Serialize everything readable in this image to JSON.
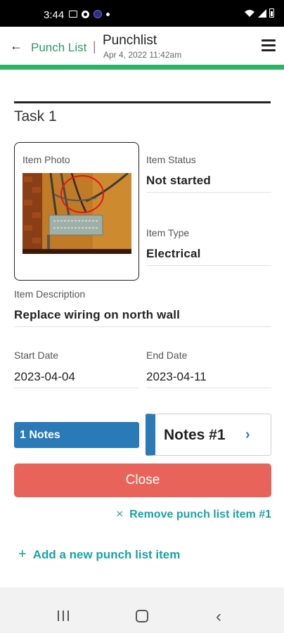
{
  "status_bar": {
    "time": "3:44"
  },
  "header": {
    "back_label": "Punch List",
    "separator": "|",
    "title": "Punchlist",
    "subtitle": "Apr 4, 2022 11:42am",
    "back_icon": "arrow-left-icon",
    "menu_icon": "hamburger-menu-icon"
  },
  "task": {
    "title": "Task 1",
    "photo_label": "Item Photo",
    "status": {
      "label": "Item Status",
      "value": "Not started"
    },
    "type": {
      "label": "Item Type",
      "value": "Electrical"
    },
    "description": {
      "label": "Item Description",
      "value": "Replace wiring on north wall"
    },
    "start_date": {
      "label": "Start Date",
      "value": "2023-04-04"
    },
    "end_date": {
      "label": "End Date",
      "value": "2023-04-11"
    }
  },
  "notes": {
    "button_label": "1 Notes",
    "card_label": "Notes #1",
    "chevron": "›"
  },
  "actions": {
    "close_label": "Close",
    "remove_icon": "×",
    "remove_label": "Remove punch list item #1",
    "add_icon": "+",
    "add_label": "Add a new punch list item"
  },
  "colors": {
    "accent_green": "#2db366",
    "notes_blue": "#2a7ab8",
    "close_red": "#e8645a",
    "link_teal": "#1aa3a3"
  }
}
